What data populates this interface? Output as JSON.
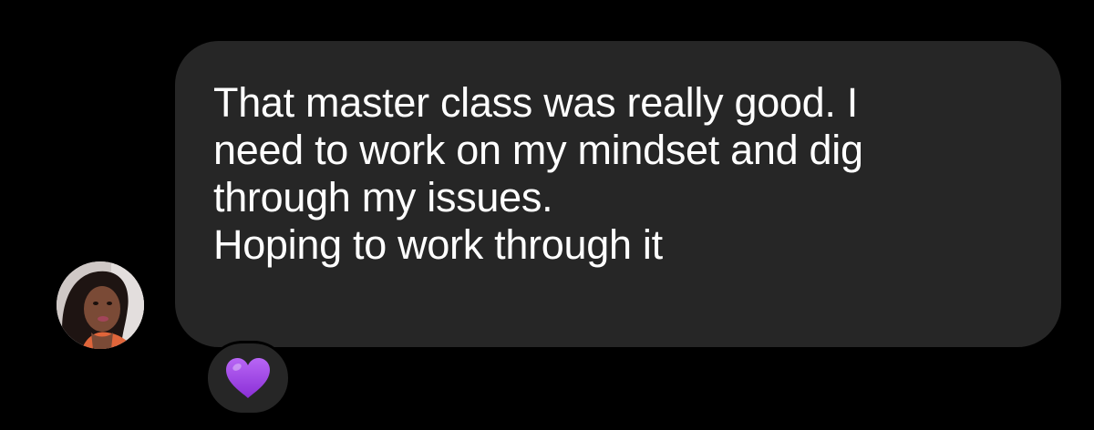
{
  "message": {
    "text": "That master class was really good. I\nneed to work on my mindset and dig\nthrough my issues.\nHoping to work through it",
    "bubble_color": "#262626",
    "text_color": "#ffffff"
  },
  "reaction": {
    "emoji_name": "purple-heart-icon",
    "color": "#9b3fe0"
  },
  "sender": {
    "avatar_icon": "avatar"
  },
  "background_color": "#000000"
}
